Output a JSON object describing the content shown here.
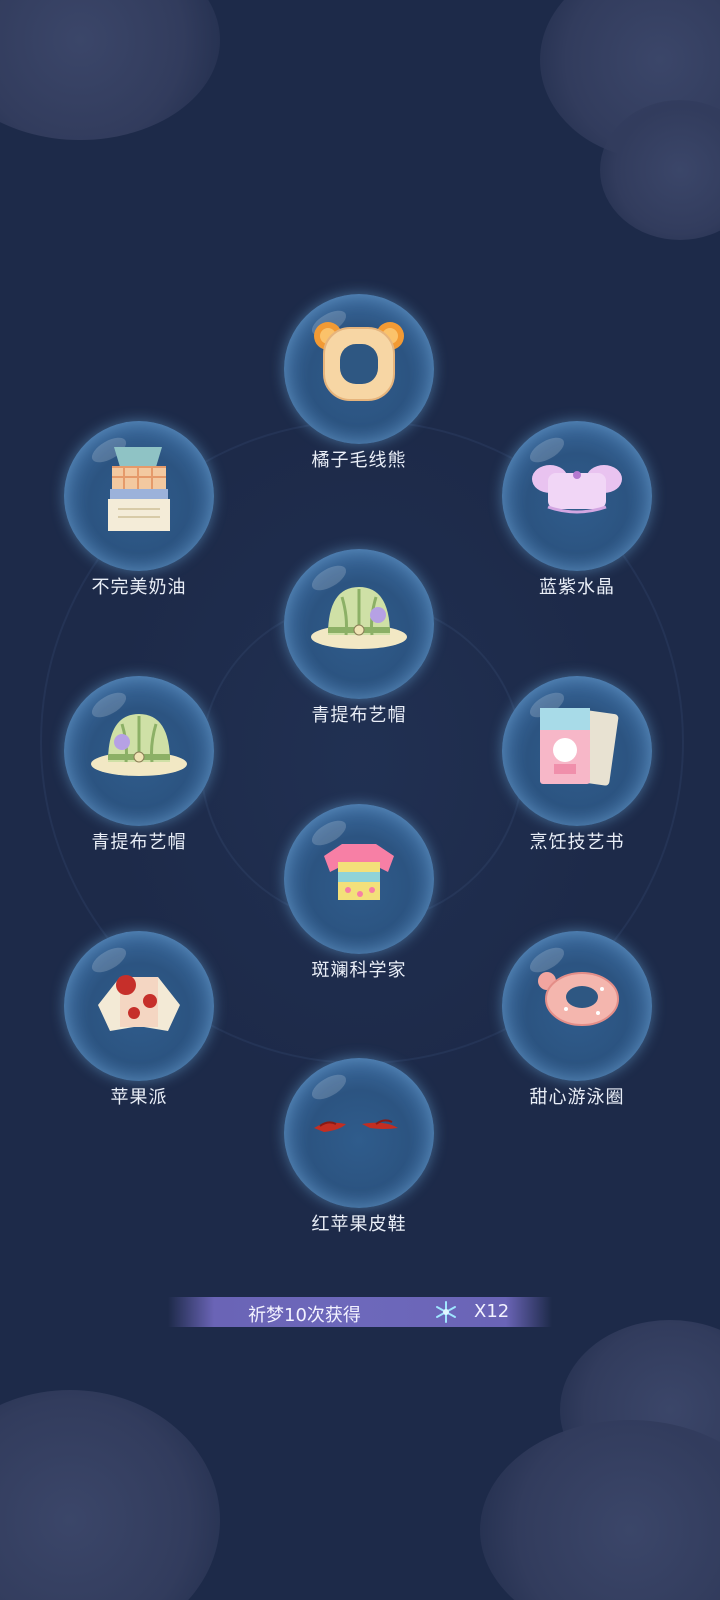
{
  "rewards": [
    {
      "name": "橘子毛线熊",
      "icon": "orange-bear-headband"
    },
    {
      "name": "不完美奶油",
      "icon": "plaid-dress"
    },
    {
      "name": "蓝紫水晶",
      "icon": "lilac-crop-top"
    },
    {
      "name": "青提布艺帽",
      "icon": "green-bucket-hat"
    },
    {
      "name": "青提布艺帽",
      "icon": "green-bucket-hat"
    },
    {
      "name": "烹饪技艺书",
      "icon": "cooking-book"
    },
    {
      "name": "斑斓科学家",
      "icon": "colorful-shirt"
    },
    {
      "name": "苹果派",
      "icon": "apple-cardigan"
    },
    {
      "name": "甜心游泳圈",
      "icon": "pink-swim-ring"
    },
    {
      "name": "红苹果皮鞋",
      "icon": "red-slippers"
    }
  ],
  "banner": {
    "text": "祈梦10次获得",
    "icon": "snowflake-crystal-icon",
    "count": "X12"
  },
  "colors": {
    "background": "#1d2a49",
    "bubble_glow": "#8fc6ef",
    "banner": "#6d68bb",
    "label": "#e9eef7"
  }
}
